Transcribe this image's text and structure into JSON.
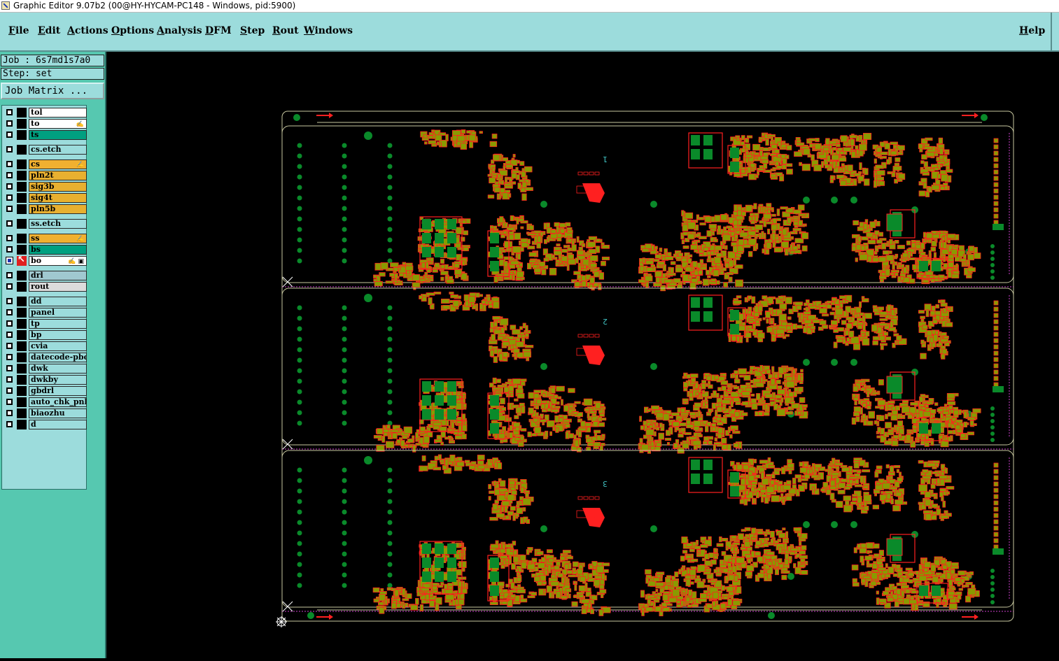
{
  "window": {
    "title": "Graphic Editor 9.07b2 (00@HY-HYCAM-PC148 - Windows, pid:5900)"
  },
  "menu": {
    "items": [
      {
        "label": "File",
        "mnemonic": "F",
        "rest": "ile"
      },
      {
        "label": "Edit",
        "mnemonic": "E",
        "rest": "dit"
      },
      {
        "label": "Actions",
        "mnemonic": "A",
        "rest": "ctions"
      },
      {
        "label": "Options",
        "mnemonic": "O",
        "rest": "ptions"
      },
      {
        "label": "Analysis",
        "mnemonic": "A",
        "rest": "nalysis"
      },
      {
        "label": "DFM",
        "mnemonic": "D",
        "rest": "FM"
      },
      {
        "label": "Step",
        "mnemonic": "S",
        "rest": "tep"
      },
      {
        "label": "Rout",
        "mnemonic": "R",
        "rest": "out"
      },
      {
        "label": "Windows",
        "mnemonic": "W",
        "rest": "indows"
      }
    ],
    "help": {
      "label": "Help",
      "mnemonic": "H",
      "rest": "elp"
    }
  },
  "job": {
    "label": "Job : 6s7md1s7a0"
  },
  "step": {
    "label": "Step: set"
  },
  "job_matrix_label": "Job Matrix ...",
  "layers": [
    {
      "name": "tol",
      "color": "#ffffff",
      "flag": "",
      "checked": false,
      "mark": "none"
    },
    {
      "name": "to",
      "color": "#ffffff",
      "flag": "✍",
      "checked": false,
      "mark": "none"
    },
    {
      "name": "ts",
      "color": "#00a080",
      "flag": "",
      "checked": false,
      "mark": "none"
    },
    {
      "name": "cs.etch",
      "color": "#9cdcdc",
      "flag": "",
      "checked": false,
      "mark": "none"
    },
    {
      "name": "cs",
      "color": "#f0b030",
      "flag": "✍",
      "checked": false,
      "mark": "none"
    },
    {
      "name": "pln2t",
      "color": "#e8b030",
      "flag": "",
      "checked": false,
      "mark": "none"
    },
    {
      "name": "sig3b",
      "color": "#e8b030",
      "flag": "",
      "checked": false,
      "mark": "none"
    },
    {
      "name": "sig4t",
      "color": "#e8b030",
      "flag": "",
      "checked": false,
      "mark": "none"
    },
    {
      "name": "pln5b",
      "color": "#e8b030",
      "flag": "",
      "checked": false,
      "mark": "none"
    },
    {
      "name": "ss.etch",
      "color": "#9cdcdc",
      "flag": "",
      "checked": false,
      "mark": "none"
    },
    {
      "name": "ss",
      "color": "#f0b030",
      "flag": "✍",
      "checked": false,
      "mark": "none"
    },
    {
      "name": "bs",
      "color": "#00a080",
      "flag": "",
      "checked": false,
      "mark": "none"
    },
    {
      "name": "bo",
      "color": "#ffffff",
      "flag": "✍ ▣",
      "checked": true,
      "mark": "arrow"
    },
    {
      "name": "drl",
      "color": "#a0c8d0",
      "flag": "",
      "checked": false,
      "mark": "none"
    },
    {
      "name": "rout",
      "color": "#dcdcdc",
      "flag": "",
      "checked": false,
      "mark": "none"
    },
    {
      "name": "dd",
      "color": "#9cdcdc",
      "flag": "",
      "checked": false,
      "mark": "none"
    },
    {
      "name": "panel",
      "color": "#9cdcdc",
      "flag": "",
      "checked": false,
      "mark": "none"
    },
    {
      "name": "tp",
      "color": "#9cdcdc",
      "flag": "",
      "checked": false,
      "mark": "none"
    },
    {
      "name": "bp",
      "color": "#9cdcdc",
      "flag": "",
      "checked": false,
      "mark": "none"
    },
    {
      "name": "cvia",
      "color": "#9cdcdc",
      "flag": "",
      "checked": false,
      "mark": "none"
    },
    {
      "name": "datecode-pbo",
      "color": "#9cdcdc",
      "flag": "",
      "checked": false,
      "mark": "none"
    },
    {
      "name": "dwk",
      "color": "#9cdcdc",
      "flag": "",
      "checked": false,
      "mark": "none"
    },
    {
      "name": "dwkby",
      "color": "#9cdcdc",
      "flag": "",
      "checked": false,
      "mark": "none"
    },
    {
      "name": "gbdrl",
      "color": "#9cdcdc",
      "flag": "",
      "checked": false,
      "mark": "none"
    },
    {
      "name": "auto_chk_pnl",
      "color": "#9cdcdc",
      "flag": "",
      "checked": false,
      "mark": "none"
    },
    {
      "name": "biaozhu",
      "color": "#9cdcdc",
      "flag": "",
      "checked": false,
      "mark": "none"
    },
    {
      "name": "d",
      "color": "#9cdcdc",
      "flag": "",
      "checked": false,
      "mark": "none"
    }
  ],
  "board": {
    "panel_labels": [
      "1",
      "2",
      "3"
    ],
    "colors": {
      "pad": "#8a9a00",
      "outline": "#ff2020",
      "green": "#0a8a2a",
      "border": "#c8c8a0",
      "magenta": "#d040d0"
    }
  }
}
